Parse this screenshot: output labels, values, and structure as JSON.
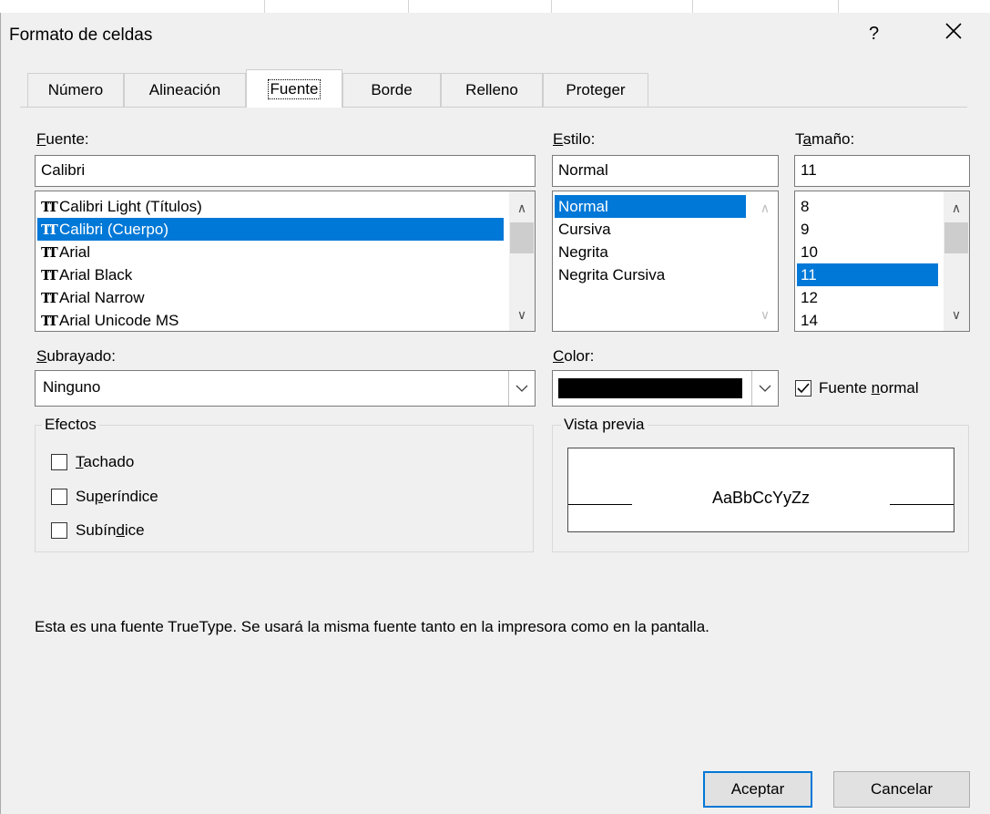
{
  "dialog": {
    "title": "Formato de celdas",
    "help": "?",
    "close": "✕"
  },
  "tabs": [
    {
      "label": "Número"
    },
    {
      "label": "Alineación"
    },
    {
      "label": "Fuente"
    },
    {
      "label": "Borde"
    },
    {
      "label": "Relleno"
    },
    {
      "label": "Proteger"
    }
  ],
  "active_tab": "Fuente",
  "font": {
    "label_first": "F",
    "label_rest": "uente:",
    "value": "Calibri",
    "list": [
      {
        "name": "Calibri Light (Títulos)",
        "selected": false
      },
      {
        "name": "Calibri (Cuerpo)",
        "selected": true
      },
      {
        "name": "Arial",
        "selected": false
      },
      {
        "name": "Arial Black",
        "selected": false
      },
      {
        "name": "Arial Narrow",
        "selected": false
      },
      {
        "name": "Arial Unicode MS",
        "selected": false
      }
    ],
    "truetype_icon": "TT"
  },
  "style": {
    "label_first": "E",
    "label_rest": "stilo:",
    "value": "Normal",
    "list": [
      {
        "name": "Normal",
        "selected": true
      },
      {
        "name": "Cursiva",
        "selected": false
      },
      {
        "name": "Negrita",
        "selected": false
      },
      {
        "name": "Negrita Cursiva",
        "selected": false
      }
    ]
  },
  "size": {
    "label_pre": "T",
    "label_u": "a",
    "label_post": "maño:",
    "value": "11",
    "list": [
      {
        "name": "8",
        "selected": false
      },
      {
        "name": "9",
        "selected": false
      },
      {
        "name": "10",
        "selected": false
      },
      {
        "name": "11",
        "selected": true
      },
      {
        "name": "12",
        "selected": false
      },
      {
        "name": "14",
        "selected": false
      }
    ]
  },
  "underline": {
    "label_first": "S",
    "label_rest": "ubrayado:",
    "value": "Ninguno"
  },
  "color": {
    "label_first": "C",
    "label_rest": "olor:",
    "swatch": "#000000"
  },
  "normal_font": {
    "label_pre": "Fuente ",
    "label_u": "n",
    "label_post": "ormal",
    "checked": true
  },
  "effects": {
    "legend": "Efectos",
    "items": [
      {
        "pre": "",
        "u": "T",
        "post": "achado",
        "checked": false
      },
      {
        "pre": "Su",
        "u": "p",
        "post": "eríndice",
        "checked": false
      },
      {
        "pre": "Subín",
        "u": "d",
        "post": "ice",
        "checked": false
      }
    ]
  },
  "preview": {
    "legend": "Vista previa",
    "sample": "AaBbCcYyZz"
  },
  "info_text": "Esta es una fuente TrueType. Se usará la misma fuente tanto en la impresora como en la pantalla.",
  "buttons": {
    "ok": "Aceptar",
    "cancel": "Cancelar"
  },
  "icons": {
    "chevron_up": "∧",
    "chevron_down": "∨",
    "combo_arrow": "chevron-down-icon",
    "check": "✓"
  }
}
